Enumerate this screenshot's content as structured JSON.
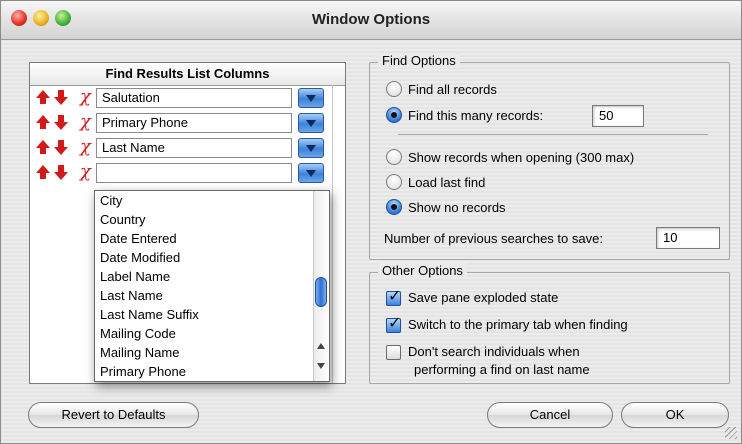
{
  "window": {
    "title": "Window Options"
  },
  "columns_list": {
    "header": "Find Results List Columns",
    "rows": [
      {
        "value": "Salutation"
      },
      {
        "value": "Primary Phone"
      },
      {
        "value": "Last Name"
      },
      {
        "value": ""
      }
    ],
    "dropdown_items": [
      "City",
      "Country",
      "Date Entered",
      "Date Modified",
      "Label Name",
      "Last Name",
      "Last Name Suffix",
      "Mailing Code",
      "Mailing Name",
      "Primary Phone"
    ]
  },
  "find_options": {
    "title": "Find Options",
    "find_all": "Find all records",
    "find_many": "Find this many records:",
    "find_many_value": "50",
    "show_opening": "Show records when opening (300 max)",
    "load_last": "Load last find",
    "show_none": "Show no records",
    "selected_top": "find_many",
    "selected_bottom": "show_none",
    "prev_searches_label": "Number of previous searches to save:",
    "prev_searches_value": "10"
  },
  "other_options": {
    "title": "Other Options",
    "save_pane": "Save pane exploded state",
    "save_pane_checked": true,
    "switch_tab": "Switch to the primary tab when finding",
    "switch_tab_checked": true,
    "dont_search_line1": "Don't search individuals when",
    "dont_search_line2": "performing a find on last name",
    "dont_search_checked": false
  },
  "buttons": {
    "revert": "Revert to Defaults",
    "cancel": "Cancel",
    "ok": "OK"
  },
  "icons": {
    "move_up": "up-arrow-icon",
    "move_down": "down-arrow-icon",
    "remove": "remove-x-icon",
    "popup": "popup-arrow-icon"
  },
  "colors": {
    "accent": "#3d83d8",
    "arrow_red": "#d21a1a"
  }
}
